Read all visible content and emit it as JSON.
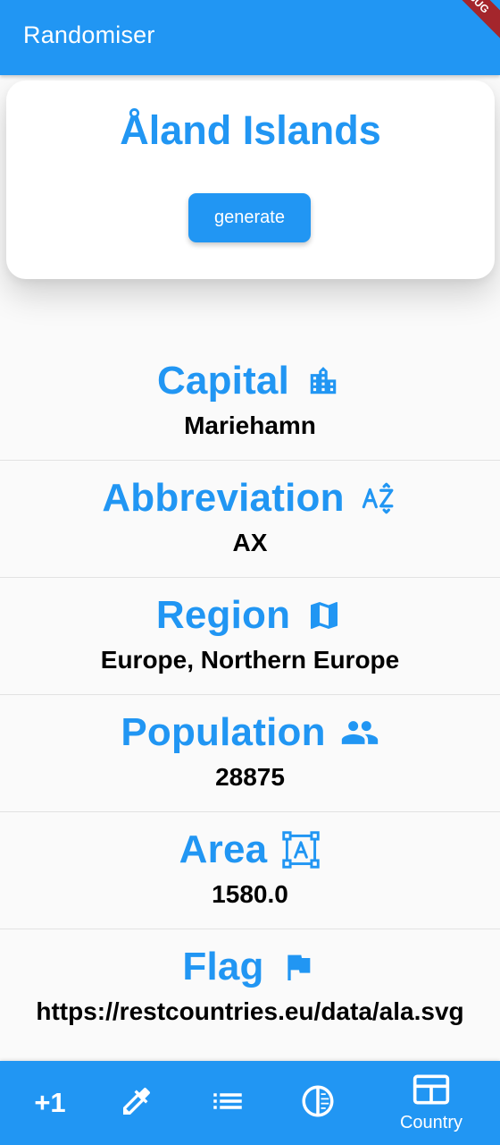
{
  "appbar": {
    "title": "Randomiser",
    "debug": "DEBUG"
  },
  "card": {
    "country": "Åland Islands",
    "button": "generate"
  },
  "sections": [
    {
      "label": "Capital",
      "icon": "building-icon",
      "value": "Mariehamn"
    },
    {
      "label": "Abbreviation",
      "icon": "sort-az-icon",
      "value": "AX"
    },
    {
      "label": "Region",
      "icon": "map-icon",
      "value": "Europe, Northern Europe"
    },
    {
      "label": "Population",
      "icon": "people-icon",
      "value": "28875"
    },
    {
      "label": "Area",
      "icon": "area-select-icon",
      "value": "1580.0"
    },
    {
      "label": "Flag",
      "icon": "flag-icon",
      "value": "https://restcountries.eu/data/ala.svg"
    }
  ],
  "bottomnav": {
    "items": [
      {
        "icon": "plus-one-icon",
        "text": "+1"
      },
      {
        "icon": "eyedropper-icon"
      },
      {
        "icon": "list-icon"
      },
      {
        "icon": "contrast-icon"
      },
      {
        "icon": "country-card-icon",
        "label": "Country",
        "selected": true
      }
    ]
  },
  "colors": {
    "primary": "#2196F3",
    "background": "#fafafa"
  }
}
